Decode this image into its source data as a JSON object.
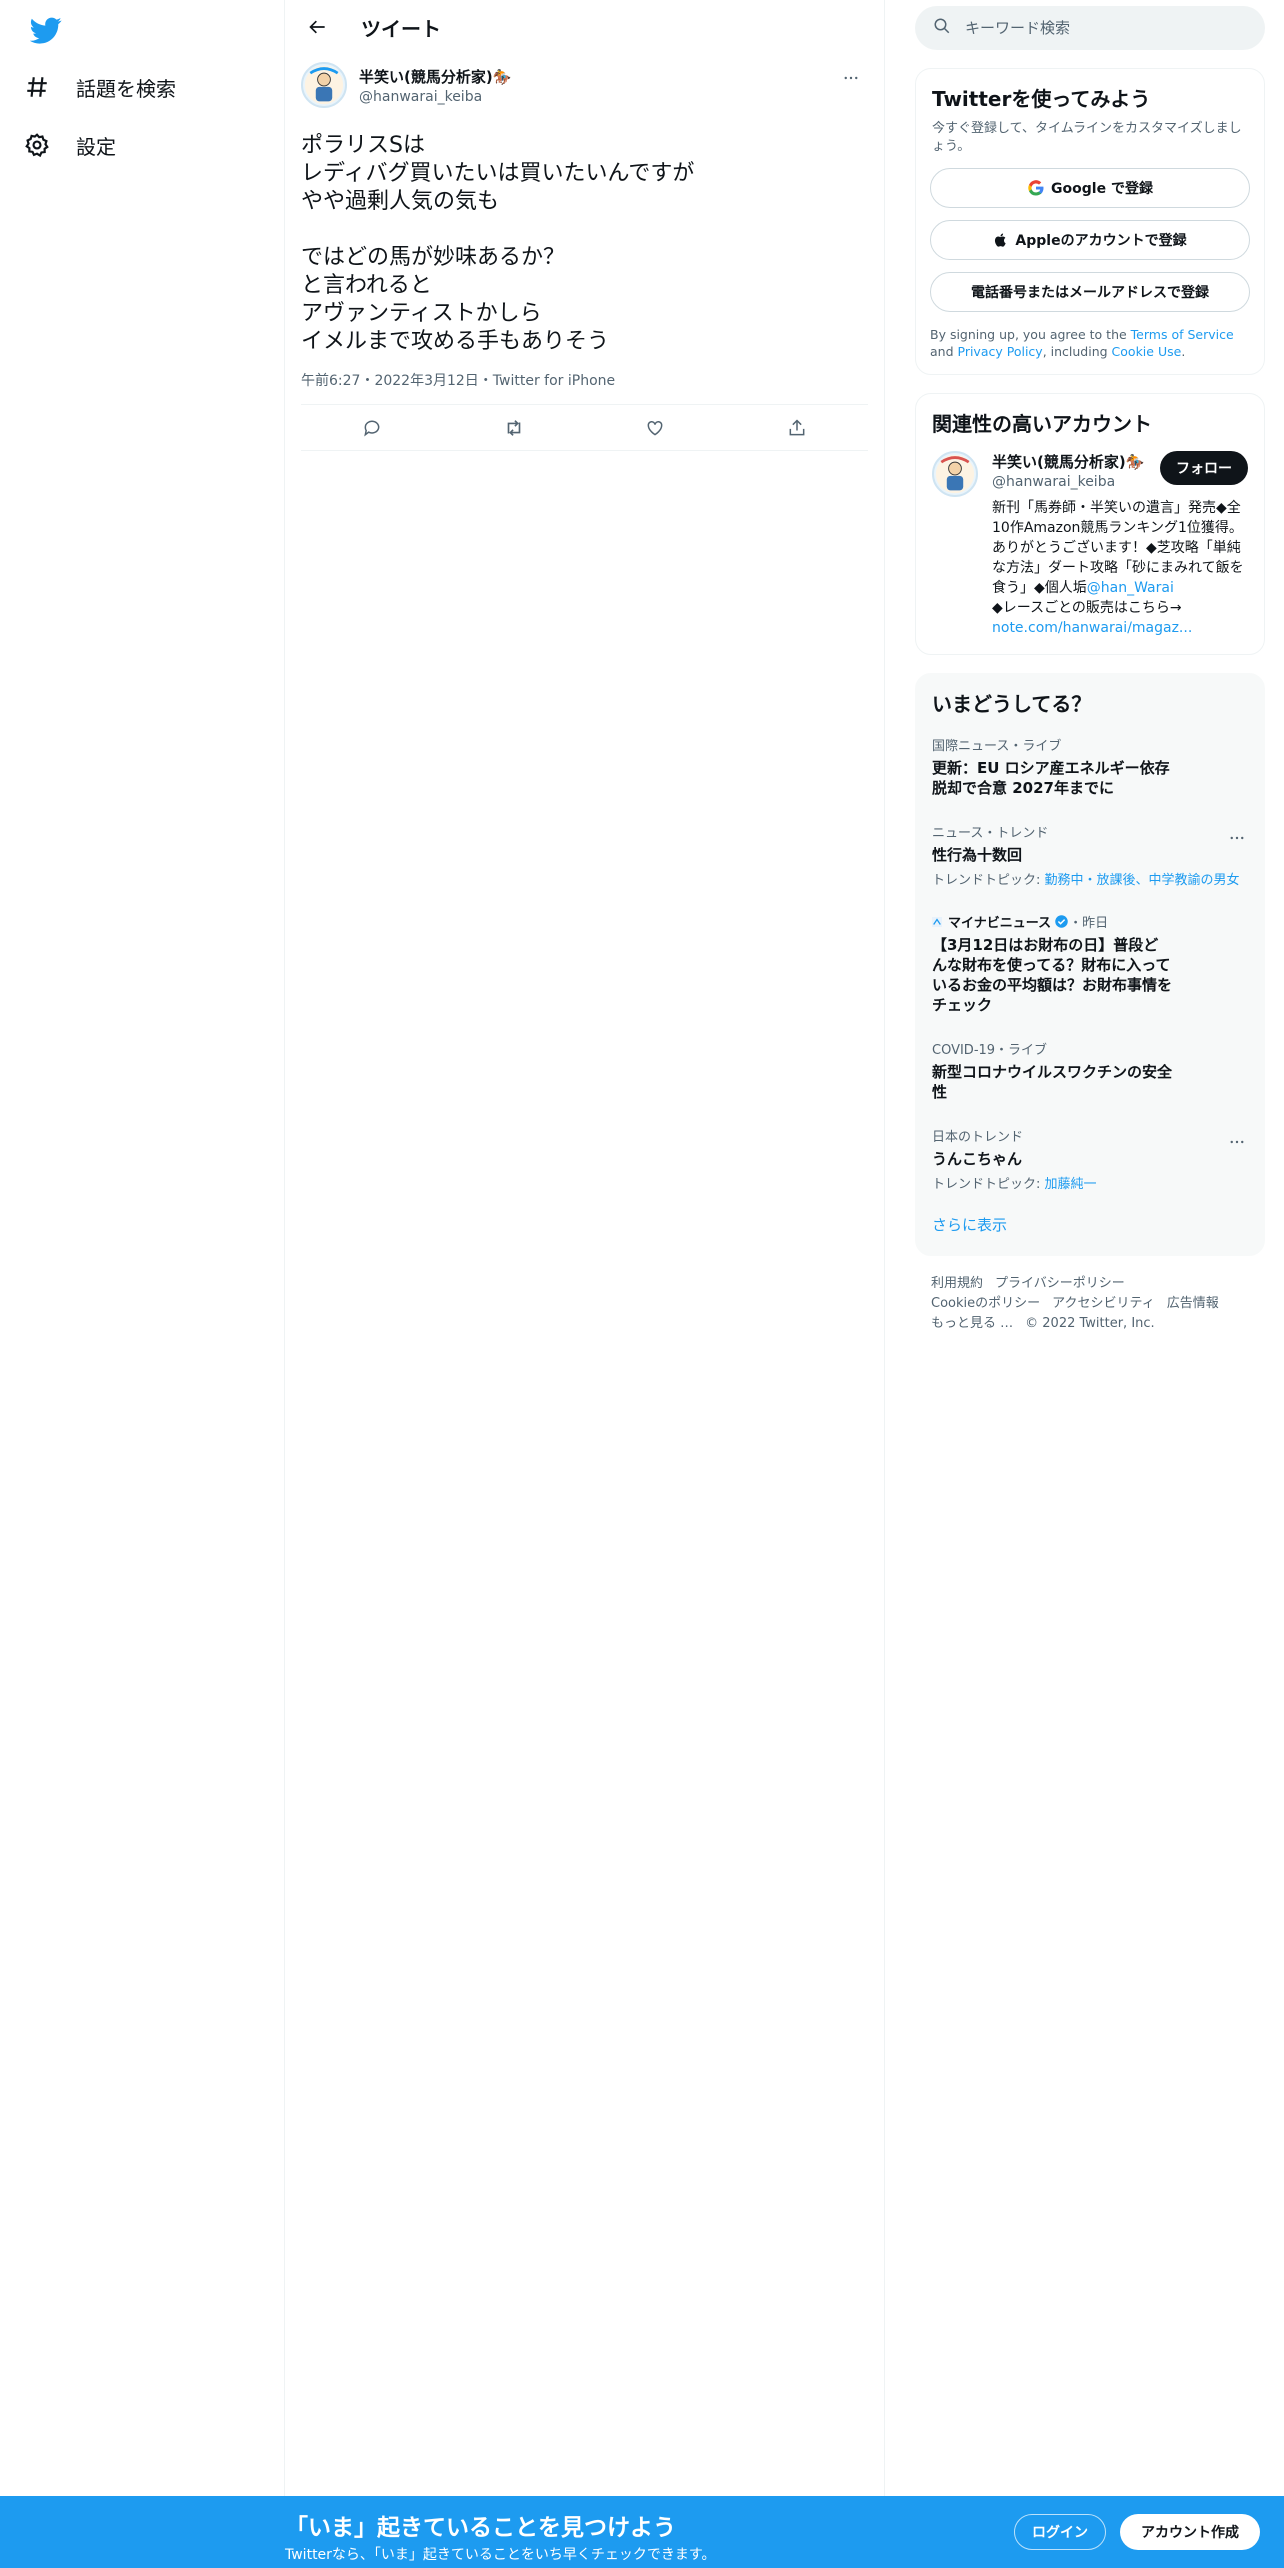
{
  "colors": {
    "accent": "#1d9bf0",
    "text": "#0f1419",
    "secondary": "#536471",
    "border": "#eff3f4"
  },
  "sidebar": {
    "logo_icon": "twitter-bird-icon",
    "items": [
      {
        "label": "話題を検索",
        "icon": "hashtag-icon"
      },
      {
        "label": "設定",
        "icon": "gear-icon"
      }
    ]
  },
  "header": {
    "title": "ツイート",
    "back_icon": "arrow-left-icon"
  },
  "tweet": {
    "author_name": "半笑い(競馬分析家)🏇",
    "author_handle": "@hanwarai_keiba",
    "text": "ポラリスSは\nレディバグ買いたいは買いたいんですが\nやや過剰人気の気も\n\nではどの馬が妙味あるか？\nと言われると\nアヴァンティストかしら\nイメルまで攻める手もありそう",
    "meta": "午前6:27・2022年3月12日・Twitter for iPhone",
    "actions": [
      "reply-icon",
      "retweet-icon",
      "like-icon",
      "share-icon"
    ]
  },
  "search": {
    "placeholder": "キーワード検索"
  },
  "signup_card": {
    "title": "Twitterを使ってみよう",
    "subtitle": "今すぐ登録して、タイムラインをカスタマイズしましょう。",
    "google_label": "Google で登録",
    "apple_label": "Appleのアカウントで登録",
    "phone_label": "電話番号またはメールアドレスで登録",
    "terms_pre": "By signing up, you agree to the ",
    "terms_link": "Terms of Service",
    "terms_and": " and ",
    "privacy_link": "Privacy Policy",
    "terms_including": ", including ",
    "cookie_link": "Cookie Use",
    "terms_end": "."
  },
  "related_card": {
    "title": "関連性の高いアカウント",
    "name": "半笑い(競馬分析家)🏇",
    "handle": "@hanwarai_keiba",
    "follow_label": "フォロー",
    "bio_text": "新刊「馬券師・半笑いの遺言」発売◆全10作Amazon競馬ランキング1位獲得。ありがとうございます！◆芝攻略「単純な方法」ダート攻略「砂にまみれて飯を食う」◆個人垢",
    "bio_mention": "@han_Warai",
    "bio_text2": "◆レースごとの販売はこちら→",
    "bio_link": "note.com/hanwarai/magaz..."
  },
  "trends_card": {
    "title": "いまどうしてる？",
    "items": [
      {
        "context": "国際ニュース・ライブ",
        "title": "更新：EU ロシア産エネルギー依存脱却で合意 2027年までに"
      },
      {
        "context": "ニュース・トレンド",
        "title": "性行為十数回",
        "topic_label": "トレンドトピック: ",
        "topic_link": "勤務中・放課後、中学教諭の男女"
      },
      {
        "source": "マイナビニュース",
        "source_time": "・昨日",
        "title": "【3月12日はお財布の日】普段どんな財布を使ってる？財布に入っているお金の平均額は？お財布事情をチェック"
      },
      {
        "context": "COVID-19・ライブ",
        "title": "新型コロナウイルスワクチンの安全性"
      },
      {
        "context": "日本のトレンド",
        "title": "うんこちゃん",
        "topic_label": "トレンドトピック: ",
        "topic_link": "加藤純一"
      }
    ],
    "show_more": "さらに表示"
  },
  "footer": {
    "links": [
      "利用規約",
      "プライバシーポリシー",
      "Cookieのポリシー",
      "アクセシビリティ",
      "広告情報",
      "もっと見る …"
    ],
    "copyright": "© 2022 Twitter, Inc."
  },
  "bottom_bar": {
    "title": "「いま」起きていることを見つけよう",
    "subtitle": "Twitterなら、「いま」起きていることをいち早くチェックできます。",
    "login_label": "ログイン",
    "signup_label": "アカウント作成"
  }
}
